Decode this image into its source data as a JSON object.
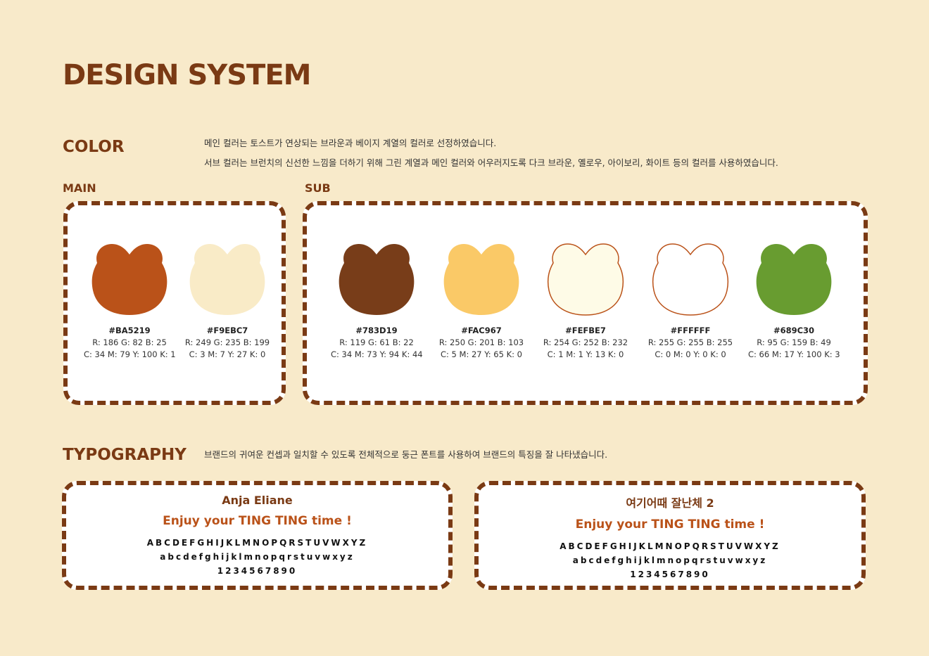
{
  "page": {
    "title": "DESIGN SYSTEM"
  },
  "color": {
    "heading": "COLOR",
    "desc_line1": "메인 컬러는 토스트가 연상되는 브라운과 베이지 계열의 컬러로 선정하였습니다.",
    "desc_line2": "서브 컬러는 브런치의 신선한 느낌을 더하기 위해 그린 계열과 메인 컬러와 어우러지도록 다크 브라운, 옐로우, 아이보리, 화이트 등의 컬러를 사용하였습니다.",
    "main_label": "MAIN",
    "sub_label": "SUB",
    "main": [
      {
        "hex": "#BA5219",
        "rgb": "R: 186 G: 82 B: 25",
        "cmyk": "C: 34 M: 79 Y: 100 K: 1",
        "fill": "#BA5219",
        "outlined": false
      },
      {
        "hex": "#F9EBC7",
        "rgb": "R: 249 G: 235 B: 199",
        "cmyk": "C: 3 M: 7 Y: 27 K: 0",
        "fill": "#F9EBC7",
        "outlined": false
      }
    ],
    "sub": [
      {
        "hex": "#783D19",
        "rgb": "R: 119 G: 61 B: 22",
        "cmyk": "C: 34 M: 73 Y: 94 K: 44",
        "fill": "#783D19",
        "outlined": false
      },
      {
        "hex": "#FAC967",
        "rgb": "R: 250 G: 201 B: 103",
        "cmyk": "C: 5 M: 27 Y: 65 K: 0",
        "fill": "#FAC967",
        "outlined": false
      },
      {
        "hex": "#FEFBE7",
        "rgb": "R: 254 G: 252 B: 232",
        "cmyk": "C: 1 M: 1 Y: 13 K: 0",
        "fill": "#FEFBE7",
        "outlined": true
      },
      {
        "hex": "#FFFFFF",
        "rgb": "R: 255 G: 255 B: 255",
        "cmyk": "C: 0 M: 0 Y: 0 K: 0",
        "fill": "#FFFFFF",
        "outlined": true
      },
      {
        "hex": "#689C30",
        "rgb": "R: 95 G: 159 B: 49",
        "cmyk": "C: 66 M: 17 Y: 100 K: 3",
        "fill": "#689C30",
        "outlined": false
      }
    ]
  },
  "typography": {
    "heading": "TYPOGRAPHY",
    "desc": "브랜드의 귀여운 컨셉과 일치할 수 있도록 전체적으로 둥근 폰트를 사용하여 브랜드의 특징을 잘 나타냈습니다.",
    "fonts": [
      {
        "name": "Anja Eliane",
        "sample": "Enjuy your TING TING time !",
        "upper": "ABCDEFGHIJKLMNOPQRSTUVWXYZ",
        "lower": "abcdefghijklmnopqrstuvwxyz",
        "digits": "1234567890"
      },
      {
        "name": "여기어때 잘난체 2",
        "sample": "Enjuy your TING TING time !",
        "upper": "ABCDEFGHIJKLMNOPQRSTUVWXYZ",
        "lower": "abcdefghijklmnopqrstuvwxyz",
        "digits": "1234567890"
      }
    ]
  },
  "colors": {
    "brand_brown": "#7A3A14",
    "accent": "#BA5219",
    "background": "#F8EACA"
  }
}
